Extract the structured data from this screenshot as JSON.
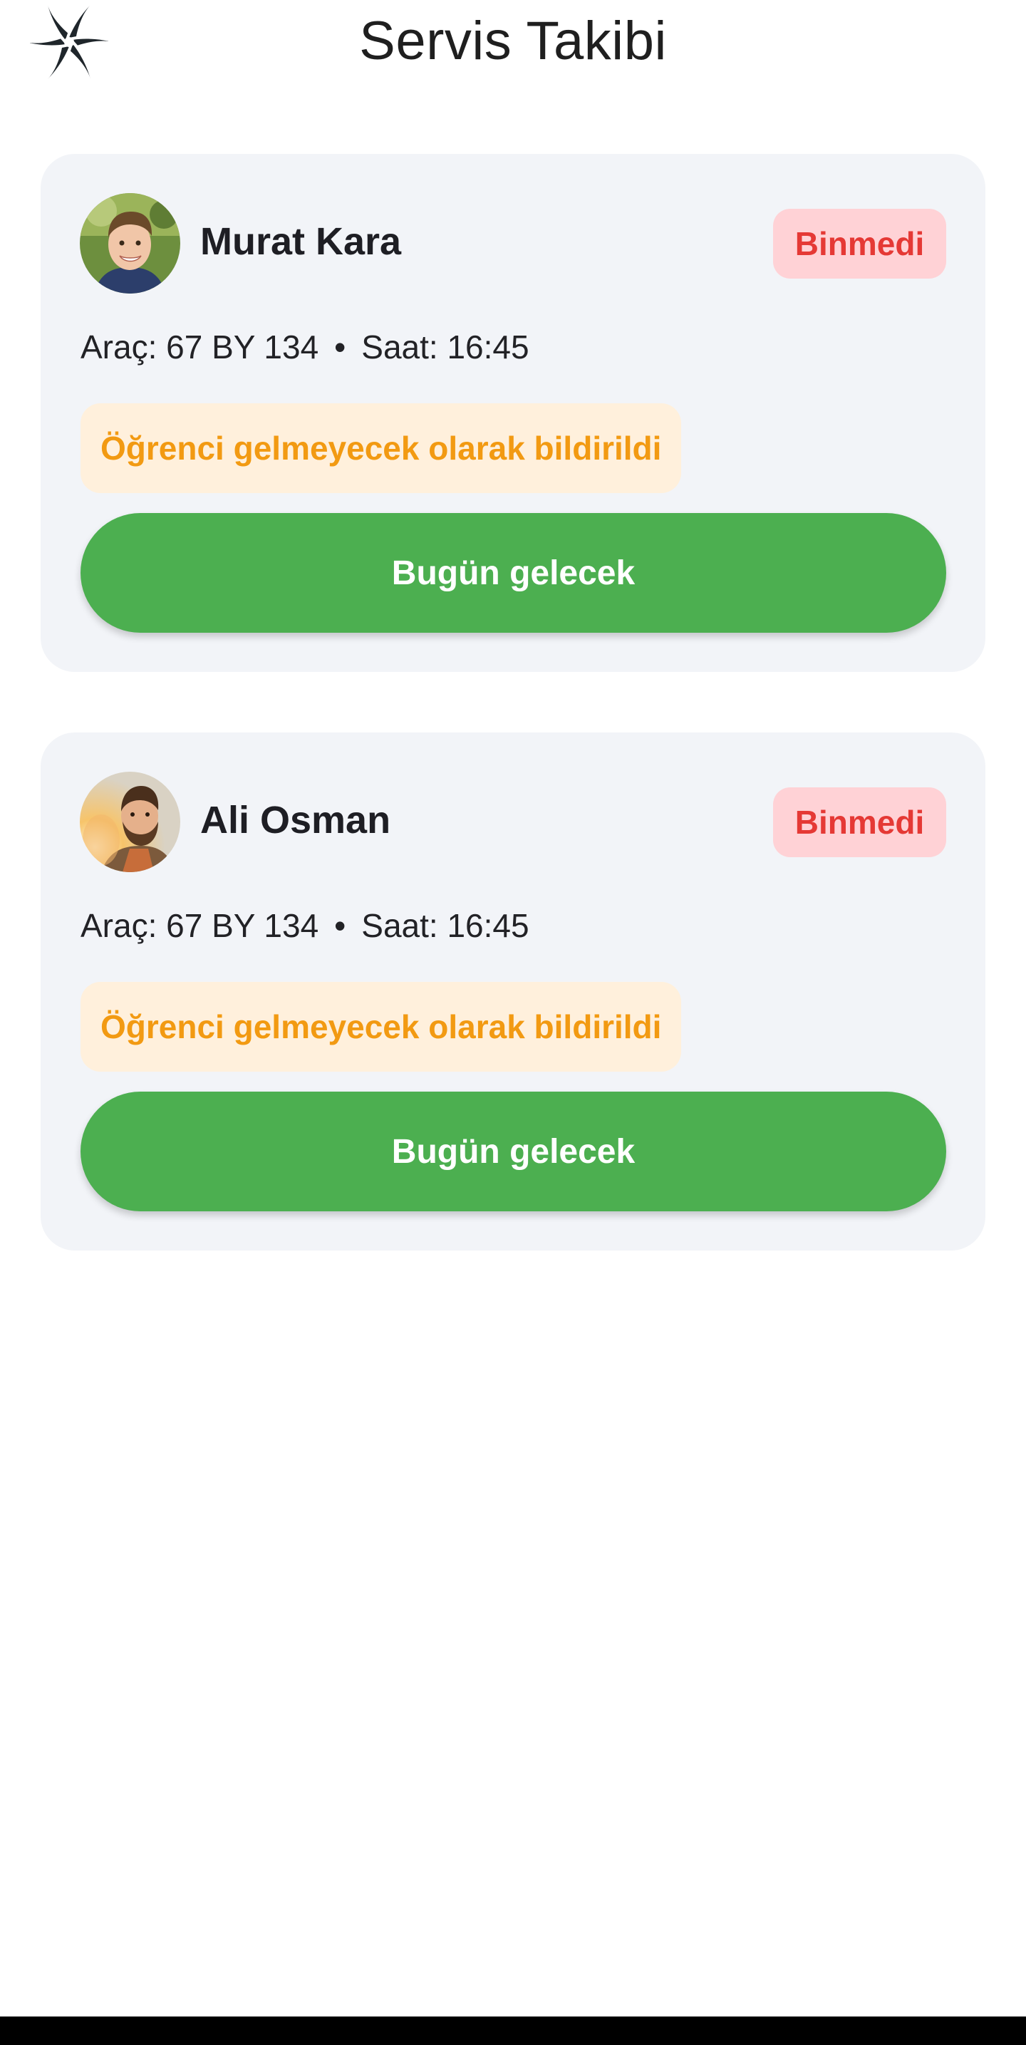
{
  "header": {
    "title": "Servis Takibi",
    "logo_icon": "pinwheel-logo-icon"
  },
  "colors": {
    "card_bg": "#f2f4f8",
    "badge_bg": "#ffd2d6",
    "badge_text": "#e53935",
    "notice_bg": "#fff0dc",
    "notice_text": "#f29a12",
    "button_bg": "#4caf50"
  },
  "students": [
    {
      "name": "Murat Kara",
      "status": "Binmedi",
      "vehicle_label": "Araç: 67 BY 134",
      "separator": "•",
      "time_label": "Saat: 16:45",
      "notice": "Öğrenci gelmeyecek olarak bildirildi",
      "button_label": "Bugün gelecek",
      "avatar_icon": "boy-avatar"
    },
    {
      "name": "Ali Osman",
      "status": "Binmedi",
      "vehicle_label": "Araç: 67 BY 134",
      "separator": "•",
      "time_label": "Saat: 16:45",
      "notice": "Öğrenci gelmeyecek olarak bildirildi",
      "button_label": "Bugün gelecek",
      "avatar_icon": "bearded-man-avatar"
    }
  ]
}
